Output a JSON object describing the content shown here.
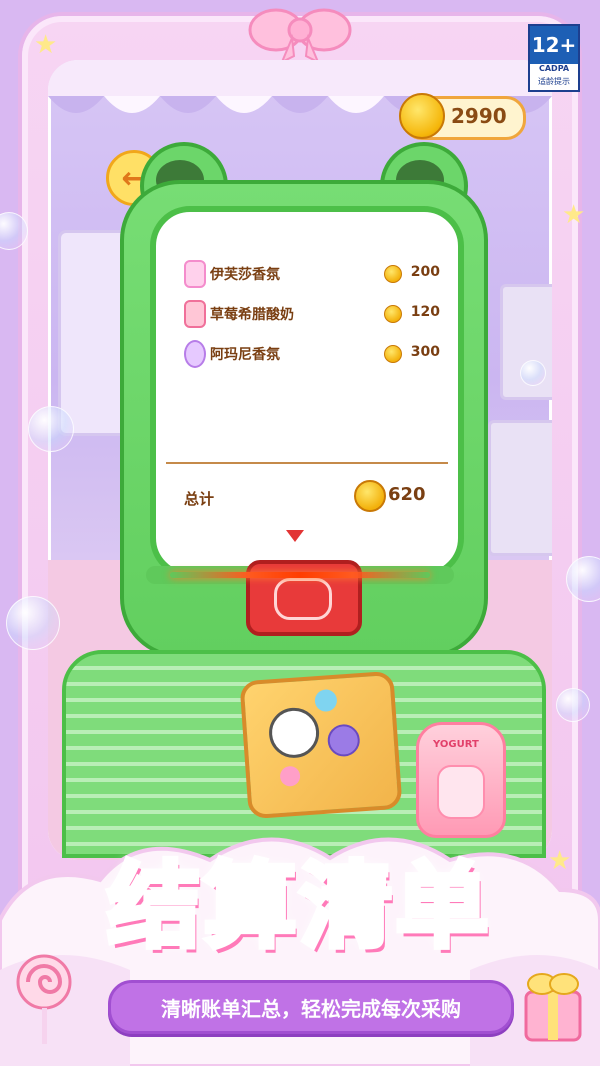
{
  "header": {
    "coin_balance": "2990",
    "age_rating": {
      "label": "12+",
      "org": "CADPA",
      "note": "适龄提示"
    }
  },
  "receipt": {
    "items": [
      {
        "name": "伊芙莎香氛",
        "price": "200",
        "icon": "perfume-bottle-icon"
      },
      {
        "name": "草莓希腊酸奶",
        "price": "120",
        "icon": "yogurt-cup-icon"
      },
      {
        "name": "阿玛尼香氛",
        "price": "300",
        "icon": "perfume-flask-icon"
      }
    ],
    "total_label": "总计",
    "total_value": "620"
  },
  "products": {
    "yogurt_label": "YOGURT"
  },
  "banner": {
    "title": "结算清单",
    "subtitle": "清晰账单汇总，轻松完成每次采购"
  },
  "colors": {
    "frog_green": "#6cd66a",
    "frame_pink": "#f7d5f3",
    "title_pink": "#ff96cf",
    "subtitle_purple": "#c072e6",
    "coin_gold": "#f5b60a"
  }
}
